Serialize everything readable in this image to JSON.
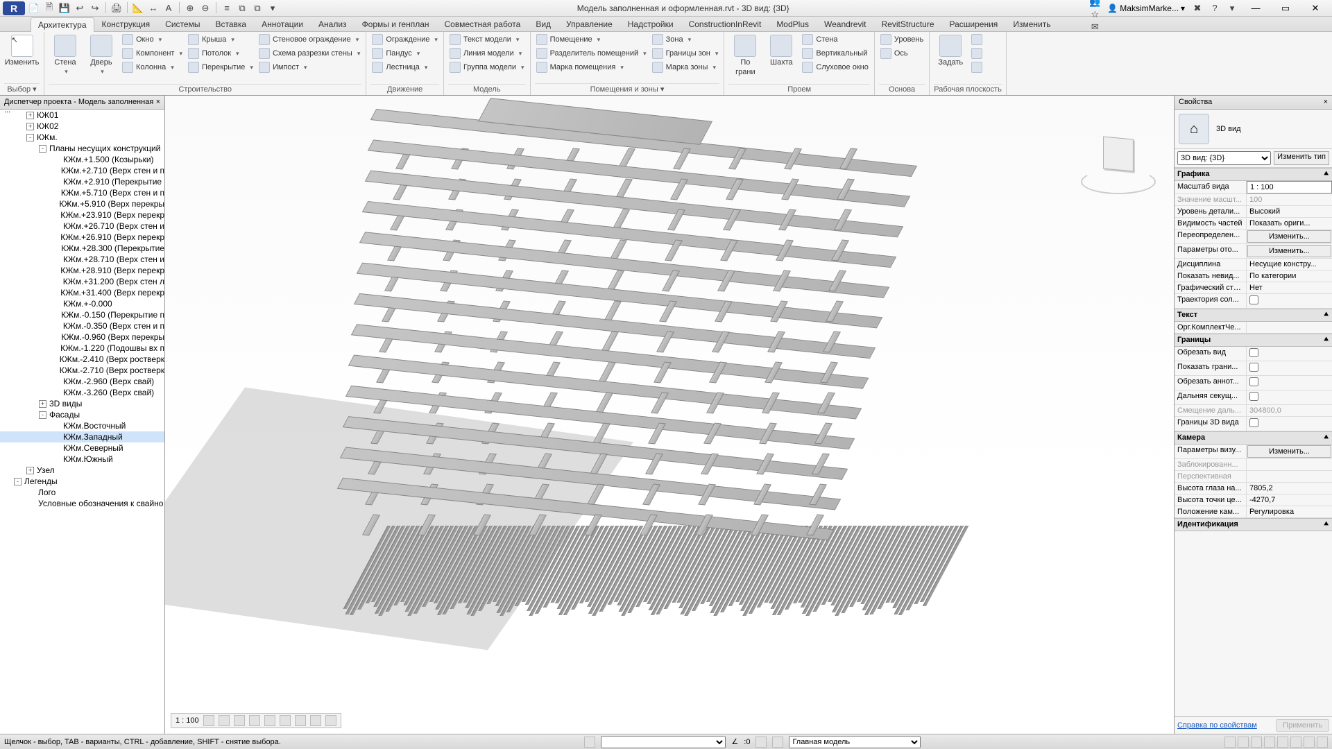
{
  "title": "Модель заполненная и оформленная.rvt - 3D вид: {3D}",
  "user": "MaksimMarke...",
  "qat": [
    "📄",
    "🗎",
    "💾",
    "↩",
    "↪",
    "·",
    "🖨",
    "·",
    "📐",
    "↔",
    "A",
    "·",
    "⊕",
    "⊖",
    "·",
    "≡",
    "⧉",
    "⧉",
    "▾"
  ],
  "title_right_icons": [
    "⌂",
    "👥",
    "☆",
    "✉"
  ],
  "help_icon": "?",
  "win": {
    "min": "—",
    "max": "▭",
    "close": "✕"
  },
  "ribbon_tabs": [
    "Архитектура",
    "Конструкция",
    "Системы",
    "Вставка",
    "Аннотации",
    "Анализ",
    "Формы и генплан",
    "Совместная работа",
    "Вид",
    "Управление",
    "Надстройки",
    "ConstructionInRevit",
    "ModPlus",
    "Weandrevit",
    "RevitStructure",
    "Расширения",
    "Изменить"
  ],
  "active_tab": 0,
  "ribbon": {
    "modify": {
      "label": "Изменить",
      "panel": "Выбор ▾"
    },
    "build": {
      "panel": "Строительство",
      "big": [
        {
          "l1": "Стена",
          "l2": ""
        },
        {
          "l1": "Дверь",
          "l2": ""
        }
      ],
      "cols": [
        [
          "Окно",
          "Компонент",
          "Колонна"
        ],
        [
          "Крыша",
          "Потолок",
          "Перекрытие"
        ],
        [
          "Стеновое ограждение",
          "Схема разрезки стены",
          "Импост"
        ]
      ]
    },
    "circ": {
      "panel": "Движение",
      "items": [
        "Ограждение",
        "Пандус",
        "Лестница"
      ]
    },
    "model": {
      "panel": "Модель",
      "items": [
        "Текст модели",
        "Линия  модели",
        "Группа модели"
      ]
    },
    "room": {
      "panel": "Помещения и зоны ▾",
      "c1": [
        "Помещение",
        "Разделитель помещений",
        "Марка помещения"
      ],
      "c2": [
        "Зона",
        "Границы  зон",
        "Марка  зоны"
      ]
    },
    "open": {
      "panel": "Проем",
      "big": [
        {
          "l1": "По",
          "l2": "грани"
        },
        {
          "l1": "Шахта",
          "l2": ""
        }
      ],
      "items": [
        "Стена",
        "Вертикальный",
        "Слуховое окно"
      ]
    },
    "datum": {
      "panel": "Основа",
      "items": [
        "Уровень",
        "Ось"
      ]
    },
    "wp": {
      "panel": "Рабочая плоскость",
      "big": "Задать"
    }
  },
  "pb_title": "Диспетчер проекта - Модель заполненная ...",
  "tree": [
    {
      "d": 1,
      "exp": "+",
      "t": "КЖ01"
    },
    {
      "d": 1,
      "exp": "+",
      "t": "КЖ02"
    },
    {
      "d": 1,
      "exp": "-",
      "t": "КЖм."
    },
    {
      "d": 2,
      "exp": "-",
      "t": "Планы несущих конструкций"
    },
    {
      "d": 3,
      "t": "КЖм.+1.500 (Козырьки)"
    },
    {
      "d": 3,
      "t": "КЖм.+2.710 (Верх стен и п"
    },
    {
      "d": 3,
      "t": "КЖм.+2.910 (Перекрытие"
    },
    {
      "d": 3,
      "t": "КЖм.+5.710 (Верх стен и п"
    },
    {
      "d": 3,
      "t": "КЖм.+5.910 (Верх перекры"
    },
    {
      "d": 3,
      "t": "КЖм.+23.910 (Верх перекр"
    },
    {
      "d": 3,
      "t": "КЖм.+26.710 (Верх стен и"
    },
    {
      "d": 3,
      "t": "КЖм.+26.910 (Верх перекр"
    },
    {
      "d": 3,
      "t": "КЖм.+28.300 (Перекрытие"
    },
    {
      "d": 3,
      "t": "КЖм.+28.710 (Верх стен и"
    },
    {
      "d": 3,
      "t": "КЖм.+28.910 (Верх перекр"
    },
    {
      "d": 3,
      "t": "КЖм.+31.200 (Верх стен л"
    },
    {
      "d": 3,
      "t": "КЖм.+31.400 (Верх перекр"
    },
    {
      "d": 3,
      "t": "КЖм.+-0.000"
    },
    {
      "d": 3,
      "t": "КЖм.-0.150 (Перекрытие п"
    },
    {
      "d": 3,
      "t": "КЖм.-0.350 (Верх стен и п"
    },
    {
      "d": 3,
      "t": "КЖм.-0.960 (Верх перекры"
    },
    {
      "d": 3,
      "t": "КЖм.-1.220 (Подошвы вх п"
    },
    {
      "d": 3,
      "t": "КЖм.-2.410 (Верх ростверк"
    },
    {
      "d": 3,
      "t": "КЖм.-2.710 (Верх ростверк"
    },
    {
      "d": 3,
      "t": "КЖм.-2.960 (Верх свай)"
    },
    {
      "d": 3,
      "t": "КЖм.-3.260 (Верх свай)"
    },
    {
      "d": 2,
      "exp": "+",
      "t": "3D виды"
    },
    {
      "d": 2,
      "exp": "-",
      "t": "Фасады"
    },
    {
      "d": 3,
      "t": "КЖм.Восточный"
    },
    {
      "d": 3,
      "t": "КЖм.Западный",
      "sel": true
    },
    {
      "d": 3,
      "t": "КЖм.Северный"
    },
    {
      "d": 3,
      "t": "КЖм.Южный"
    },
    {
      "d": 1,
      "exp": "+",
      "t": "Узел"
    },
    {
      "d": 0,
      "exp": "-",
      "t": "Легенды"
    },
    {
      "d": 1,
      "t": "Лого"
    },
    {
      "d": 1,
      "t": "Условные обозначения к свайно"
    }
  ],
  "view_scale": "1 : 100",
  "props": {
    "header": "Свойства",
    "type_label": "3D вид",
    "selector": "3D вид: {3D}",
    "edit_type": "Изменить тип",
    "groups": [
      {
        "g": "Графика",
        "rows": [
          {
            "k": "Масштаб вида",
            "v": "1 : 100",
            "in": true
          },
          {
            "k": "Значение масшт...",
            "v": "100",
            "dis": true
          },
          {
            "k": "Уровень детали...",
            "v": "Высокий"
          },
          {
            "k": "Видимость частей",
            "v": "Показать ориги..."
          },
          {
            "k": "Переопределен...",
            "btn": "Изменить..."
          },
          {
            "k": "Параметры ото...",
            "btn": "Изменить..."
          },
          {
            "k": "Дисциплина",
            "v": "Несущие констру..."
          },
          {
            "k": "Показать невид...",
            "v": "По категории"
          },
          {
            "k": "Графический сти...",
            "v": "Нет"
          },
          {
            "k": "Траектория сол...",
            "chk": false
          }
        ]
      },
      {
        "g": "Текст",
        "rows": [
          {
            "k": "Орг.КомплектЧе...",
            "v": ""
          }
        ]
      },
      {
        "g": "Границы",
        "rows": [
          {
            "k": "Обрезать вид",
            "chk": false
          },
          {
            "k": "Показать грани...",
            "chk": false
          },
          {
            "k": "Обрезать аннот...",
            "chk": false
          },
          {
            "k": "Дальняя секущ...",
            "chk": false
          },
          {
            "k": "Смещение даль...",
            "v": "304800,0",
            "dis": true
          },
          {
            "k": "Границы 3D вида",
            "chk": false
          }
        ]
      },
      {
        "g": "Камера",
        "rows": [
          {
            "k": "Параметры визу...",
            "btn": "Изменить..."
          },
          {
            "k": "Заблокированн...",
            "v": "",
            "dis": true
          },
          {
            "k": "Перспективная",
            "v": "",
            "dis": true
          },
          {
            "k": "Высота глаза на...",
            "v": "7805,2"
          },
          {
            "k": "Высота точки це...",
            "v": "-4270,7"
          },
          {
            "k": "Положение кам...",
            "v": "Регулировка"
          }
        ]
      },
      {
        "g": "Идентификация",
        "rows": []
      }
    ],
    "help_link": "Справка по свойствам",
    "apply": "Применить"
  },
  "status": {
    "hint": "Щелчок - выбор, TAB - варианты, CTRL - добавление, SHIFT - снятие выбора.",
    "angle": ":0",
    "model_sel": "Главная модель"
  }
}
